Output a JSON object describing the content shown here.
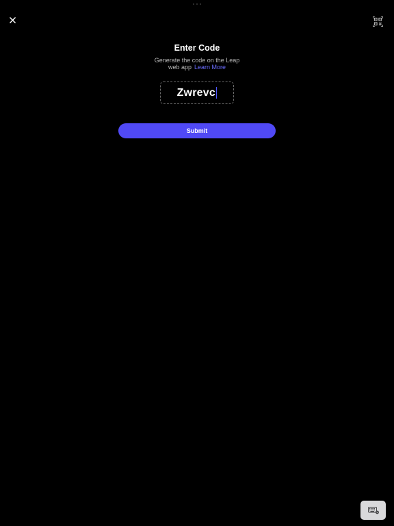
{
  "header": {
    "close_icon": "close-icon",
    "qr_icon": "qr-code-scan-icon"
  },
  "main": {
    "title": "Enter Code",
    "subtitle": "Generate the code on the Leap web app",
    "learn_more": "Learn More",
    "code_value": "Zwrevc",
    "submit_label": "Submit"
  },
  "footer": {
    "keyboard_icon": "keyboard-dismiss-icon"
  },
  "colors": {
    "background": "#000000",
    "accent": "#5049f5",
    "link": "#6a6cff",
    "caret": "#4f57ff"
  }
}
